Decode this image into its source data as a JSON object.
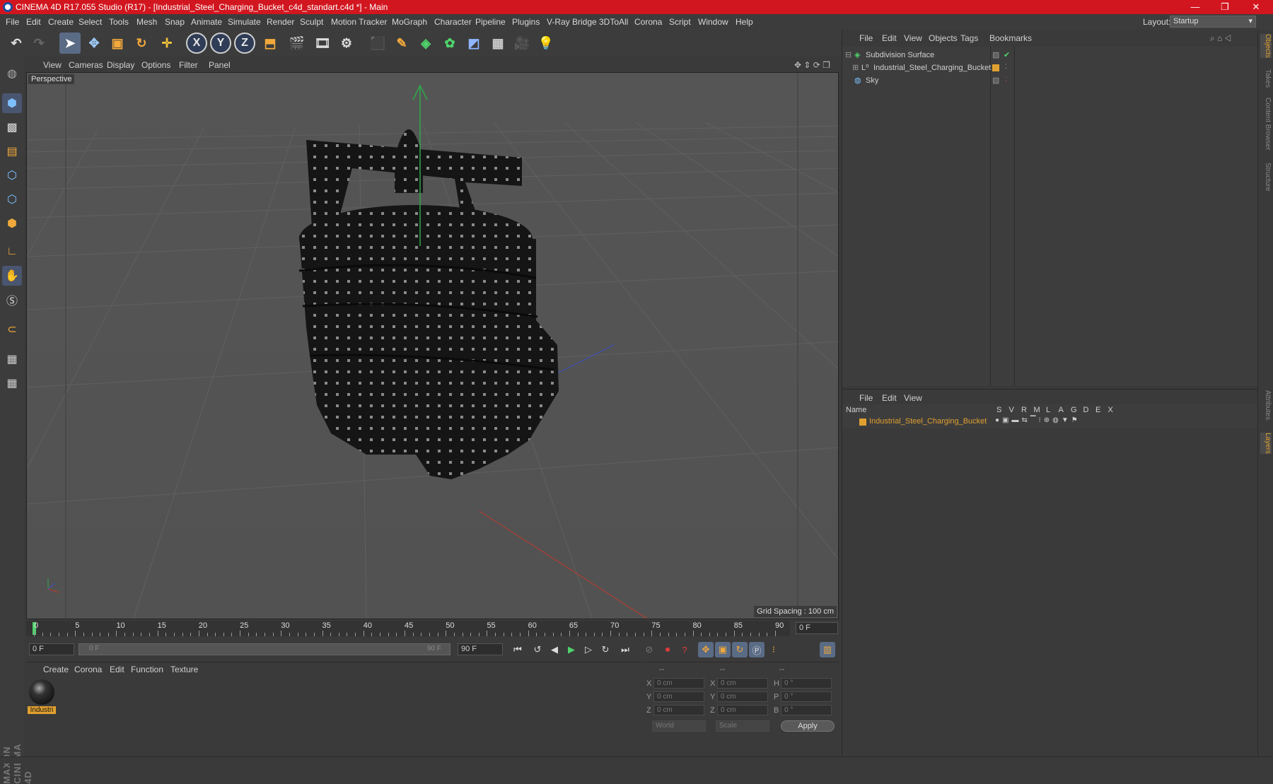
{
  "window": {
    "title": "CINEMA 4D R17.055 Studio (R17) - [Industrial_Steel_Charging_Bucket_c4d_standart.c4d *] - Main",
    "minimize": "—",
    "restore": "❐",
    "close": "✕"
  },
  "menubar": {
    "items": [
      "File",
      "Edit",
      "Create",
      "Select",
      "Tools",
      "Mesh",
      "Snap",
      "Animate",
      "Simulate",
      "Render",
      "Sculpt",
      "Motion Tracker",
      "MoGraph",
      "Character",
      "Pipeline",
      "Plugins",
      "V-Ray Bridge",
      "3DToAll",
      "Corona",
      "Script",
      "Window",
      "Help"
    ],
    "layout_label": "Layout:",
    "layout_value": "Startup"
  },
  "toolbar": {
    "axis_x": "X",
    "axis_y": "Y",
    "axis_z": "Z"
  },
  "viewport": {
    "menu": [
      "View",
      "Cameras",
      "Display",
      "Options",
      "Filter",
      "Panel"
    ],
    "label": "Perspective",
    "grid_spacing": "Grid Spacing : 100 cm"
  },
  "timeline": {
    "ticks": [
      "0",
      "5",
      "10",
      "15",
      "20",
      "25",
      "30",
      "35",
      "40",
      "45",
      "50",
      "55",
      "60",
      "65",
      "70",
      "75",
      "80",
      "85",
      "90"
    ],
    "current_frame": "0 F"
  },
  "transport": {
    "start": "0 F",
    "range_start": "0 F",
    "range_end": "90 F",
    "end": "90 F"
  },
  "materials": {
    "menu": [
      "Create",
      "Corona",
      "Edit",
      "Function",
      "Texture"
    ],
    "items": [
      {
        "name": "Industri"
      }
    ]
  },
  "coordinates": {
    "headers": [
      "--",
      "--",
      "--"
    ],
    "rows": [
      {
        "l1": "X",
        "v1": "0 cm",
        "l2": "X",
        "v2": "0 cm",
        "l3": "H",
        "v3": "0 °"
      },
      {
        "l1": "Y",
        "v1": "0 cm",
        "l2": "Y",
        "v2": "0 cm",
        "l3": "P",
        "v3": "0 °"
      },
      {
        "l1": "Z",
        "v1": "0 cm",
        "l2": "Z",
        "v2": "0 cm",
        "l3": "B",
        "v3": "0 °"
      }
    ],
    "mode1": "World",
    "mode2": "Scale",
    "apply": "Apply"
  },
  "objects_panel": {
    "menu": [
      "File",
      "Edit",
      "View",
      "Objects",
      "Tags",
      "Bookmarks"
    ],
    "objects": [
      {
        "name": "Subdivision Surface"
      },
      {
        "name": "Industrial_Steel_Charging_Bucket"
      },
      {
        "name": "Sky"
      }
    ]
  },
  "layers_panel": {
    "menu": [
      "File",
      "Edit",
      "View"
    ],
    "header_name": "Name",
    "columns": [
      "S",
      "V",
      "R",
      "M",
      "L",
      "A",
      "G",
      "D",
      "E",
      "X"
    ],
    "layer_name": "Industrial_Steel_Charging_Bucket"
  },
  "side_tabs": [
    "Objects",
    "Takes",
    "Content Browser",
    "Structure",
    "Attributes",
    "Layers"
  ],
  "branding": "MAXON CINEMA 4D",
  "colors": {
    "titlebar": "#d2161f",
    "selected_layer": "#e0a030",
    "accent_blue": "#5a6b85"
  }
}
